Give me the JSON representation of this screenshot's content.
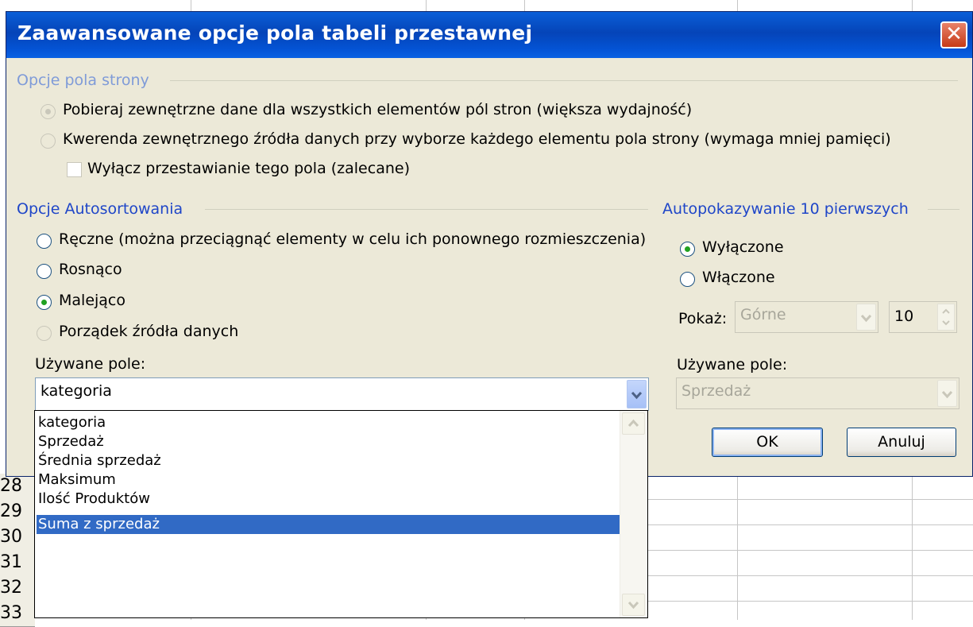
{
  "dialog": {
    "title": "Zaawansowane opcje pola tabeli przestawnej",
    "close_label": "✕"
  },
  "page_options": {
    "title": "Opcje pola strony",
    "opt_all": "Pobieraj zewnętrzne dane dla wszystkich elementów pól stron (większa wydajność)",
    "opt_query": "Kwerenda zewnętrznego źródła danych przy wyborze każdego elementu pola strony (wymaga mniej pamięci)",
    "disable_pivot": "Wyłącz przestawianie tego pola (zalecane)"
  },
  "autosort": {
    "title": "Opcje Autosortowania",
    "manual": "Ręczne (można przeciągnąć elementy w celu ich ponownego rozmieszczenia)",
    "ascending": "Rosnąco",
    "descending": "Malejąco",
    "source_order": "Porządek źródła danych",
    "field_label": "Używane pole:",
    "field_value": "kategoria",
    "list": [
      "kategoria",
      "Sprzedaż",
      "Średnia sprzedaż",
      "Maksimum",
      "Ilość Produktów",
      "Suma z sprzedaż"
    ]
  },
  "autoshow": {
    "title": "Autopokazywanie 10 pierwszych",
    "off": "Wyłączone",
    "on": "Włączone",
    "show_label": "Pokaż:",
    "show_value": "Górne",
    "count": "10",
    "field_label": "Używane pole:",
    "field_value": "Sprzedaż"
  },
  "buttons": {
    "ok": "OK",
    "cancel": "Anuluj"
  },
  "sheet": {
    "rows": [
      "28",
      "29",
      "30",
      "31",
      "32",
      "33"
    ]
  }
}
